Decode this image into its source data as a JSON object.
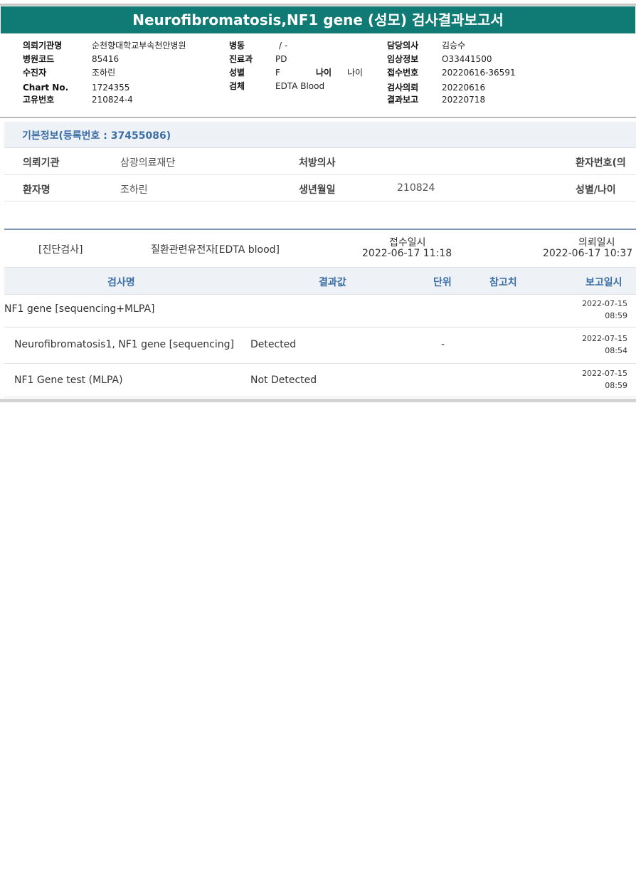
{
  "report": {
    "title": "Neurofibromatosis,NF1 gene (성모) 검사결과보고서"
  },
  "header": {
    "col1": [
      {
        "label": "의뢰기관명",
        "value": "순천향대학교부속천안병원"
      },
      {
        "label": "병원코드",
        "value": "85416"
      },
      {
        "label": "수진자",
        "value": "조하린"
      },
      {
        "label": "Chart No.",
        "value": "1724355"
      },
      {
        "label": "고유번호",
        "value": "210824-4"
      }
    ],
    "col2": [
      {
        "label": "병동",
        "value": "/ -"
      },
      {
        "label": "진료과",
        "value": "PD"
      },
      {
        "label": "성별",
        "value": "F"
      },
      {
        "label": "검체",
        "value": "EDTA Blood"
      }
    ],
    "age": {
      "label": "나이",
      "value": "나이"
    },
    "col3": [
      {
        "label": "담당의사",
        "value": "김승수"
      },
      {
        "label": "임상정보",
        "value": "O33441500"
      },
      {
        "label": "접수번호",
        "value": "20220616-36591"
      },
      {
        "label": "검사의뢰",
        "value": "20220616"
      },
      {
        "label": "결과보고",
        "value": "20220718"
      }
    ]
  },
  "basic_info": {
    "title": "기본정보(등록번호 : 37455086)",
    "row1": {
      "l1": "의뢰기관",
      "v1": "삼광의료재단",
      "l2": "처방의사",
      "v2": "",
      "l3": "환자번호(의"
    },
    "row2": {
      "l1": "환자명",
      "v1": "조하린",
      "l2": "생년월일",
      "v2": "210824",
      "l3": "성별/나이"
    }
  },
  "summary": {
    "category": "[진단검사]",
    "test_group": "질환관련유전자[EDTA blood]",
    "received_label": "접수일시",
    "received_value": "2022-06-17  11:18",
    "requested_label": "의뢰일시",
    "requested_value": "2022-06-17  10:37"
  },
  "table": {
    "headers": {
      "name": "검사명",
      "result": "결과값",
      "unit": "단위",
      "ref": "참고치",
      "report_time": "보고일시"
    },
    "rows": [
      {
        "name": "NF1 gene [sequencing+MLPA]",
        "result": "",
        "unit": "",
        "ref": "",
        "date": "2022-07-15",
        "time": "08:59"
      },
      {
        "name": "Neurofibromatosis1, NF1 gene [sequencing]",
        "result": "Detected",
        "unit": "-",
        "ref": "",
        "date": "2022-07-15",
        "time": "08:54"
      },
      {
        "name": "NF1 Gene test (MLPA)",
        "result": "Not Detected",
        "unit": "",
        "ref": "",
        "date": "2022-07-15",
        "time": "08:59"
      }
    ]
  }
}
